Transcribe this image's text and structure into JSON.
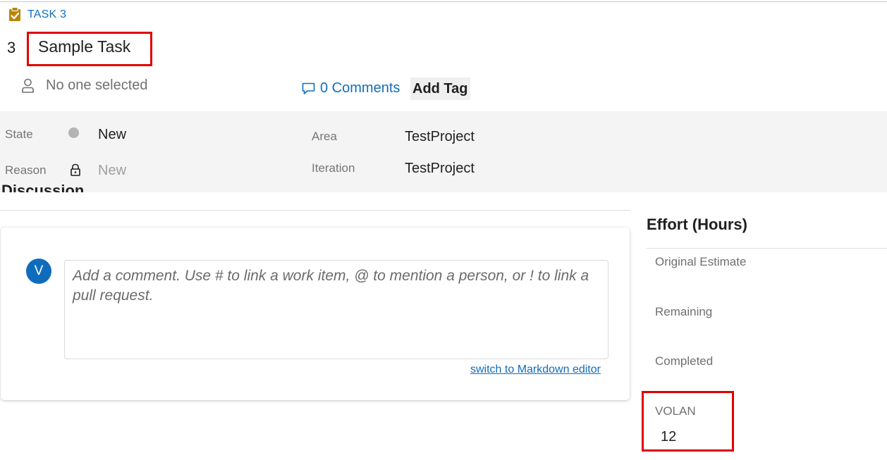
{
  "work_item": {
    "type_label": "TASK 3",
    "id": "3",
    "title": "Sample Task",
    "type_color": "#b8860b"
  },
  "header": {
    "assignee": "No one selected",
    "comments_label": "0 Comments",
    "add_tag_label": "Add Tag"
  },
  "fields": {
    "state": {
      "label": "State",
      "value": "New",
      "dot_color": "#b4b4b4"
    },
    "reason": {
      "label": "Reason",
      "value": "New"
    },
    "area": {
      "label": "Area",
      "value": "TestProject"
    },
    "iteration": {
      "label": "Iteration",
      "value": "TestProject"
    }
  },
  "discussion": {
    "heading": "Discussion",
    "avatar_initial": "V",
    "placeholder": "Add a comment. Use # to link a work item, @ to mention a person, or ! to link a pull request.",
    "markdown_link": "switch to Markdown editor"
  },
  "effort": {
    "heading": "Effort (Hours)",
    "original_estimate_label": "Original Estimate",
    "remaining_label": "Remaining",
    "completed_label": "Completed",
    "volan_label": "VOLAN",
    "volan_value": "12"
  },
  "colors": {
    "accent": "#106ebe",
    "highlight_border": "#e00000",
    "avatar": "#0f6cbd"
  }
}
